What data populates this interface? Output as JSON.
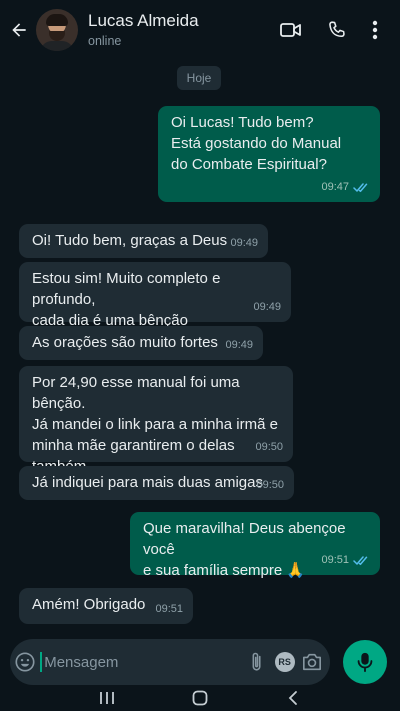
{
  "header": {
    "contact_name": "Lucas Almeida",
    "contact_status": "online"
  },
  "chat": {
    "date_label": "Hoje",
    "messages": [
      {
        "direction": "out",
        "text": "Oi Lucas! Tudo bem?\nEstá gostando do Manual\ndo Combate Espiritual?",
        "time": "09:47",
        "read": true
      },
      {
        "direction": "in",
        "text": "Oi! Tudo bem, graças a Deus",
        "time": "09:49"
      },
      {
        "direction": "in",
        "text": "Estou sim! Muito completo e profundo,\ncada dia é uma bênção",
        "time": "09:49"
      },
      {
        "direction": "in",
        "text": "As orações são muito fortes",
        "time": "09:49"
      },
      {
        "direction": "in",
        "text": "Por 24,90 esse manual foi uma bênção.\nJá mandei o link para a minha irmã e\nminha mãe garantirem o delas também.",
        "time": "09:50"
      },
      {
        "direction": "in",
        "text": "Já indiquei para mais duas amigas",
        "time": "09:50"
      },
      {
        "direction": "out",
        "text": "Que maravilha! Deus abençoe você\ne sua família sempre 🙏",
        "time": "09:51",
        "read": true
      },
      {
        "direction": "in",
        "text": "Amém! Obrigado",
        "time": "09:51"
      }
    ]
  },
  "input": {
    "placeholder": "Mensagem",
    "rs_badge": "RS"
  },
  "colors": {
    "background": "#0b141a",
    "incoming_bubble": "#1f2c34",
    "outgoing_bubble": "#005c4b",
    "accent": "#00a884",
    "read_ticks": "#53bdeb"
  }
}
